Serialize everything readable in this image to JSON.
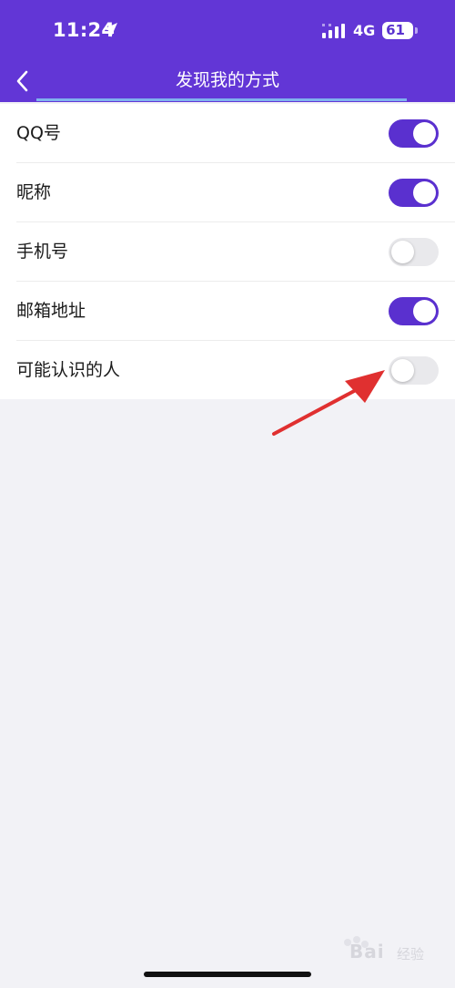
{
  "status_bar": {
    "time": "11:24",
    "network": "4G",
    "battery": "61"
  },
  "nav": {
    "title": "发现我的方式"
  },
  "settings": [
    {
      "label": "QQ号",
      "on": true
    },
    {
      "label": "昵称",
      "on": true
    },
    {
      "label": "手机号",
      "on": false
    },
    {
      "label": "邮箱地址",
      "on": true
    },
    {
      "label": "可能认识的人",
      "on": false
    }
  ],
  "watermark": {
    "text": "Bai",
    "text2": "经验"
  },
  "colors": {
    "accent": "#6236d6",
    "toggle_on": "#5a30cf",
    "toggle_off": "#e9e9ec",
    "annotation_arrow": "#e03030"
  }
}
